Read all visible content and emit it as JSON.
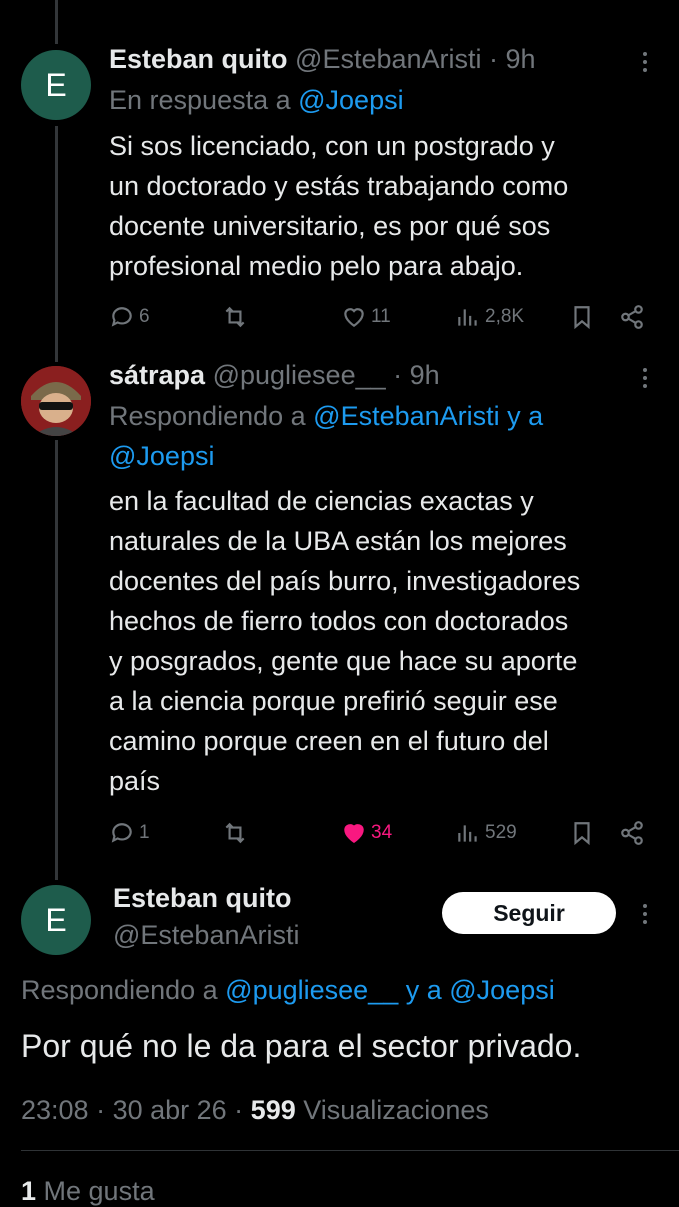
{
  "tweets": [
    {
      "avatar_letter": "E",
      "name": "Esteban quito",
      "handle": "@EstebanAristi",
      "sep": " · ",
      "time": "9h",
      "reply_prefix": "En respuesta a ",
      "reply_to": "@Joepsi",
      "text_lines": [
        "Si sos licenciado, con un postgrado y",
        "un doctorado y estás trabajando como",
        "docente universitario, es por qué sos",
        "profesional medio pelo para abajo."
      ],
      "replies": "6",
      "likes": "11",
      "views": "2,8K"
    },
    {
      "name": "sátrapa",
      "handle": "@pugliesee__",
      "sep": " · ",
      "time": "9h",
      "reply_prefix": "Respondiendo a ",
      "reply_to_1": "@EstebanAristi",
      "reply_and": " y a",
      "reply_to_2": "@Joepsi",
      "text_lines": [
        "en la facultad de ciencias exactas y",
        "naturales de la UBA están los mejores",
        "docentes del país burro, investigadores",
        "hechos de fierro todos con doctorados",
        "y posgrados, gente que hace su aporte",
        "a la ciencia porque prefirió seguir ese",
        "camino porque creen en el futuro del",
        "país"
      ],
      "replies": "1",
      "likes": "34",
      "views": "529"
    }
  ],
  "main": {
    "avatar_letter": "E",
    "name": "Esteban quito",
    "handle": "@EstebanAristi",
    "follow_label": "Seguir",
    "reply_prefix": "Respondiendo a ",
    "reply_to_1": "@pugliesee__",
    "reply_and": " y a ",
    "reply_to_2": "@Joepsi",
    "text": "Por qué no le da para el sector privado.",
    "time": "23:08",
    "sep": " · ",
    "date": "30 abr 26",
    "sep2": " · ",
    "views_count": "599",
    "views_label": " Visualizaciones",
    "likes_count": "1",
    "likes_label": " Me gusta"
  },
  "colors": {
    "accent": "#1d9bf0",
    "like": "#f91880",
    "muted": "#71767b",
    "avatar_bg": "#1e5c4c"
  }
}
